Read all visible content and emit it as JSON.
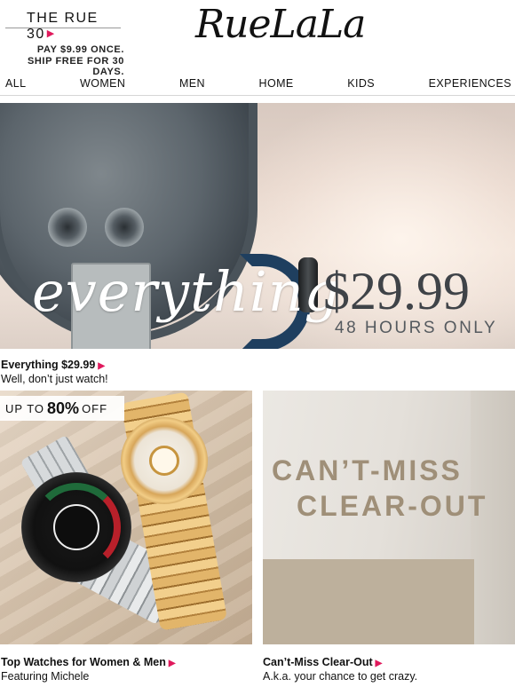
{
  "header": {
    "rue30_title": "THE RUE 30",
    "rue30_line1": "PAY $9.99 ONCE.",
    "rue30_line2": "SHIP FREE FOR 30 DAYS.",
    "logo_text": "RueLaLa",
    "logo_reg": "®"
  },
  "nav": {
    "items": [
      "ALL",
      "WOMEN",
      "MEN",
      "HOME",
      "KIDS",
      "EXPERIENCES"
    ]
  },
  "hero": {
    "headline": "everything",
    "price": "$29.99",
    "subline": "48 HOURS ONLY"
  },
  "hero_caption": {
    "title": "Everything $29.99",
    "subtitle": "Well, don’t just watch!"
  },
  "tile_watches": {
    "badge_prefix": "UP TO",
    "badge_number": "80%",
    "badge_suffix": "OFF",
    "caption_title": "Top Watches for Women & Men",
    "caption_subtitle": "Featuring Michele"
  },
  "tile_clearout": {
    "line1": "CAN’T-MISS",
    "line2": "CLEAR-OUT",
    "caption_title": "Can’t-Miss Clear-Out",
    "caption_subtitle": "A.k.a. your chance to get crazy."
  },
  "colors": {
    "accent_arrow": "#e0195c",
    "clearout_text": "#9f8f78",
    "price_text": "#3f4348"
  },
  "icons": {
    "arrow": "right-triangle-icon",
    "arrow_glyph": "▶"
  }
}
